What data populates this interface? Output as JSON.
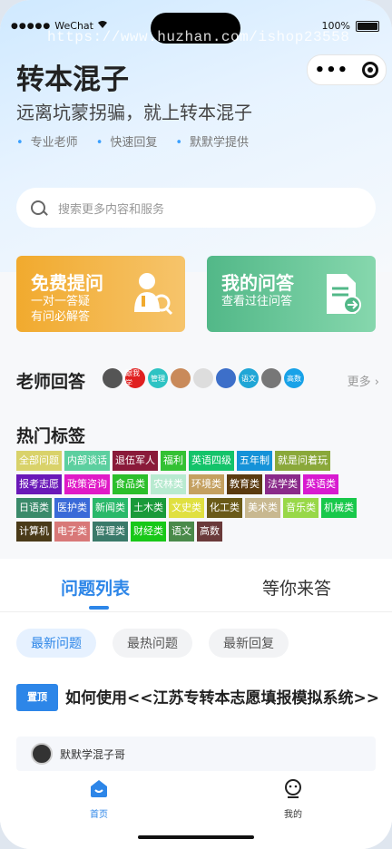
{
  "status_bar": {
    "carrier": "WeChat",
    "battery": "100%"
  },
  "watermark": "https://www.huzhan.com/ishop23558",
  "hero": {
    "title": "转本混子",
    "subtitle": "远离坑蒙拐骗，就上转本混子",
    "features": [
      "专业老师",
      "快速回复",
      "默默学提供"
    ]
  },
  "search": {
    "placeholder": "搜索更多内容和服务"
  },
  "cards": {
    "ask": {
      "title": "免费提问",
      "line1": "一对一答疑",
      "line2": "有问必解答"
    },
    "mine": {
      "title": "我的问答",
      "line1": "查看过往问答"
    }
  },
  "teachers": {
    "title": "老师回答",
    "more": "更多 ›",
    "avatars": [
      {
        "label": "",
        "color": "#555555"
      },
      {
        "label": "跟我学",
        "color": "#e02020"
      },
      {
        "label": "管理",
        "color": "#2ec3c3"
      },
      {
        "label": "",
        "color": "#c98a5a"
      },
      {
        "label": "",
        "color": "#dddddd"
      },
      {
        "label": "",
        "color": "#3d6fc9"
      },
      {
        "label": "语文",
        "color": "#20a6d6"
      },
      {
        "label": "",
        "color": "#777777"
      },
      {
        "label": "高数",
        "color": "#18a2e8"
      }
    ]
  },
  "hot_tags": {
    "title": "热门标签",
    "tags": [
      {
        "label": "全部问题",
        "color": "#d9d26a"
      },
      {
        "label": "内部谈话",
        "color": "#5ccf9f"
      },
      {
        "label": "退伍军人",
        "color": "#8a1a3a"
      },
      {
        "label": "福利",
        "color": "#33c133"
      },
      {
        "label": "英语四级",
        "color": "#14c36a"
      },
      {
        "label": "五年制",
        "color": "#1592d8"
      },
      {
        "label": "就是问着玩",
        "color": "#8aa83a"
      },
      {
        "label": "报考志愿",
        "color": "#6a18b8"
      },
      {
        "label": "政策咨询",
        "color": "#e01ac7"
      },
      {
        "label": "食品类",
        "color": "#2bbf2b"
      },
      {
        "label": "农林类",
        "color": "#b8ead0"
      },
      {
        "label": "环境类",
        "color": "#c4a060"
      },
      {
        "label": "教育类",
        "color": "#5a3a10"
      },
      {
        "label": "法学类",
        "color": "#8a2a8a"
      },
      {
        "label": "英语类",
        "color": "#d81ad0"
      },
      {
        "label": "日语类",
        "color": "#3a8a6a"
      },
      {
        "label": "医护类",
        "color": "#3a6ad8"
      },
      {
        "label": "新闻类",
        "color": "#2ab86a"
      },
      {
        "label": "土木类",
        "color": "#1a9a3a"
      },
      {
        "label": "文史类",
        "color": "#e0e040"
      },
      {
        "label": "化工类",
        "color": "#6a5a18"
      },
      {
        "label": "美术类",
        "color": "#c8b890"
      },
      {
        "label": "音乐类",
        "color": "#98d848"
      },
      {
        "label": "机械类",
        "color": "#18c84a"
      },
      {
        "label": "计算机",
        "color": "#4a3a18"
      },
      {
        "label": "电子类",
        "color": "#d87878"
      },
      {
        "label": "管理类",
        "color": "#3a7a6a"
      },
      {
        "label": "财经类",
        "color": "#18c818"
      },
      {
        "label": "语文",
        "color": "#4a8a4a"
      },
      {
        "label": "高数",
        "color": "#6a3a3a"
      }
    ]
  },
  "list_tabs": {
    "active": "问题列表",
    "inactive": "等你来答"
  },
  "filters": [
    "最新问题",
    "最热问题",
    "最新回复"
  ],
  "post": {
    "badge": "置顶",
    "title": "如何使用<<江苏专转本志愿填报模拟系统>>",
    "author": "默默学混子哥"
  },
  "tabbar": {
    "home": "首页",
    "me": "我的"
  },
  "colors": {
    "accent": "#2d86e8"
  }
}
